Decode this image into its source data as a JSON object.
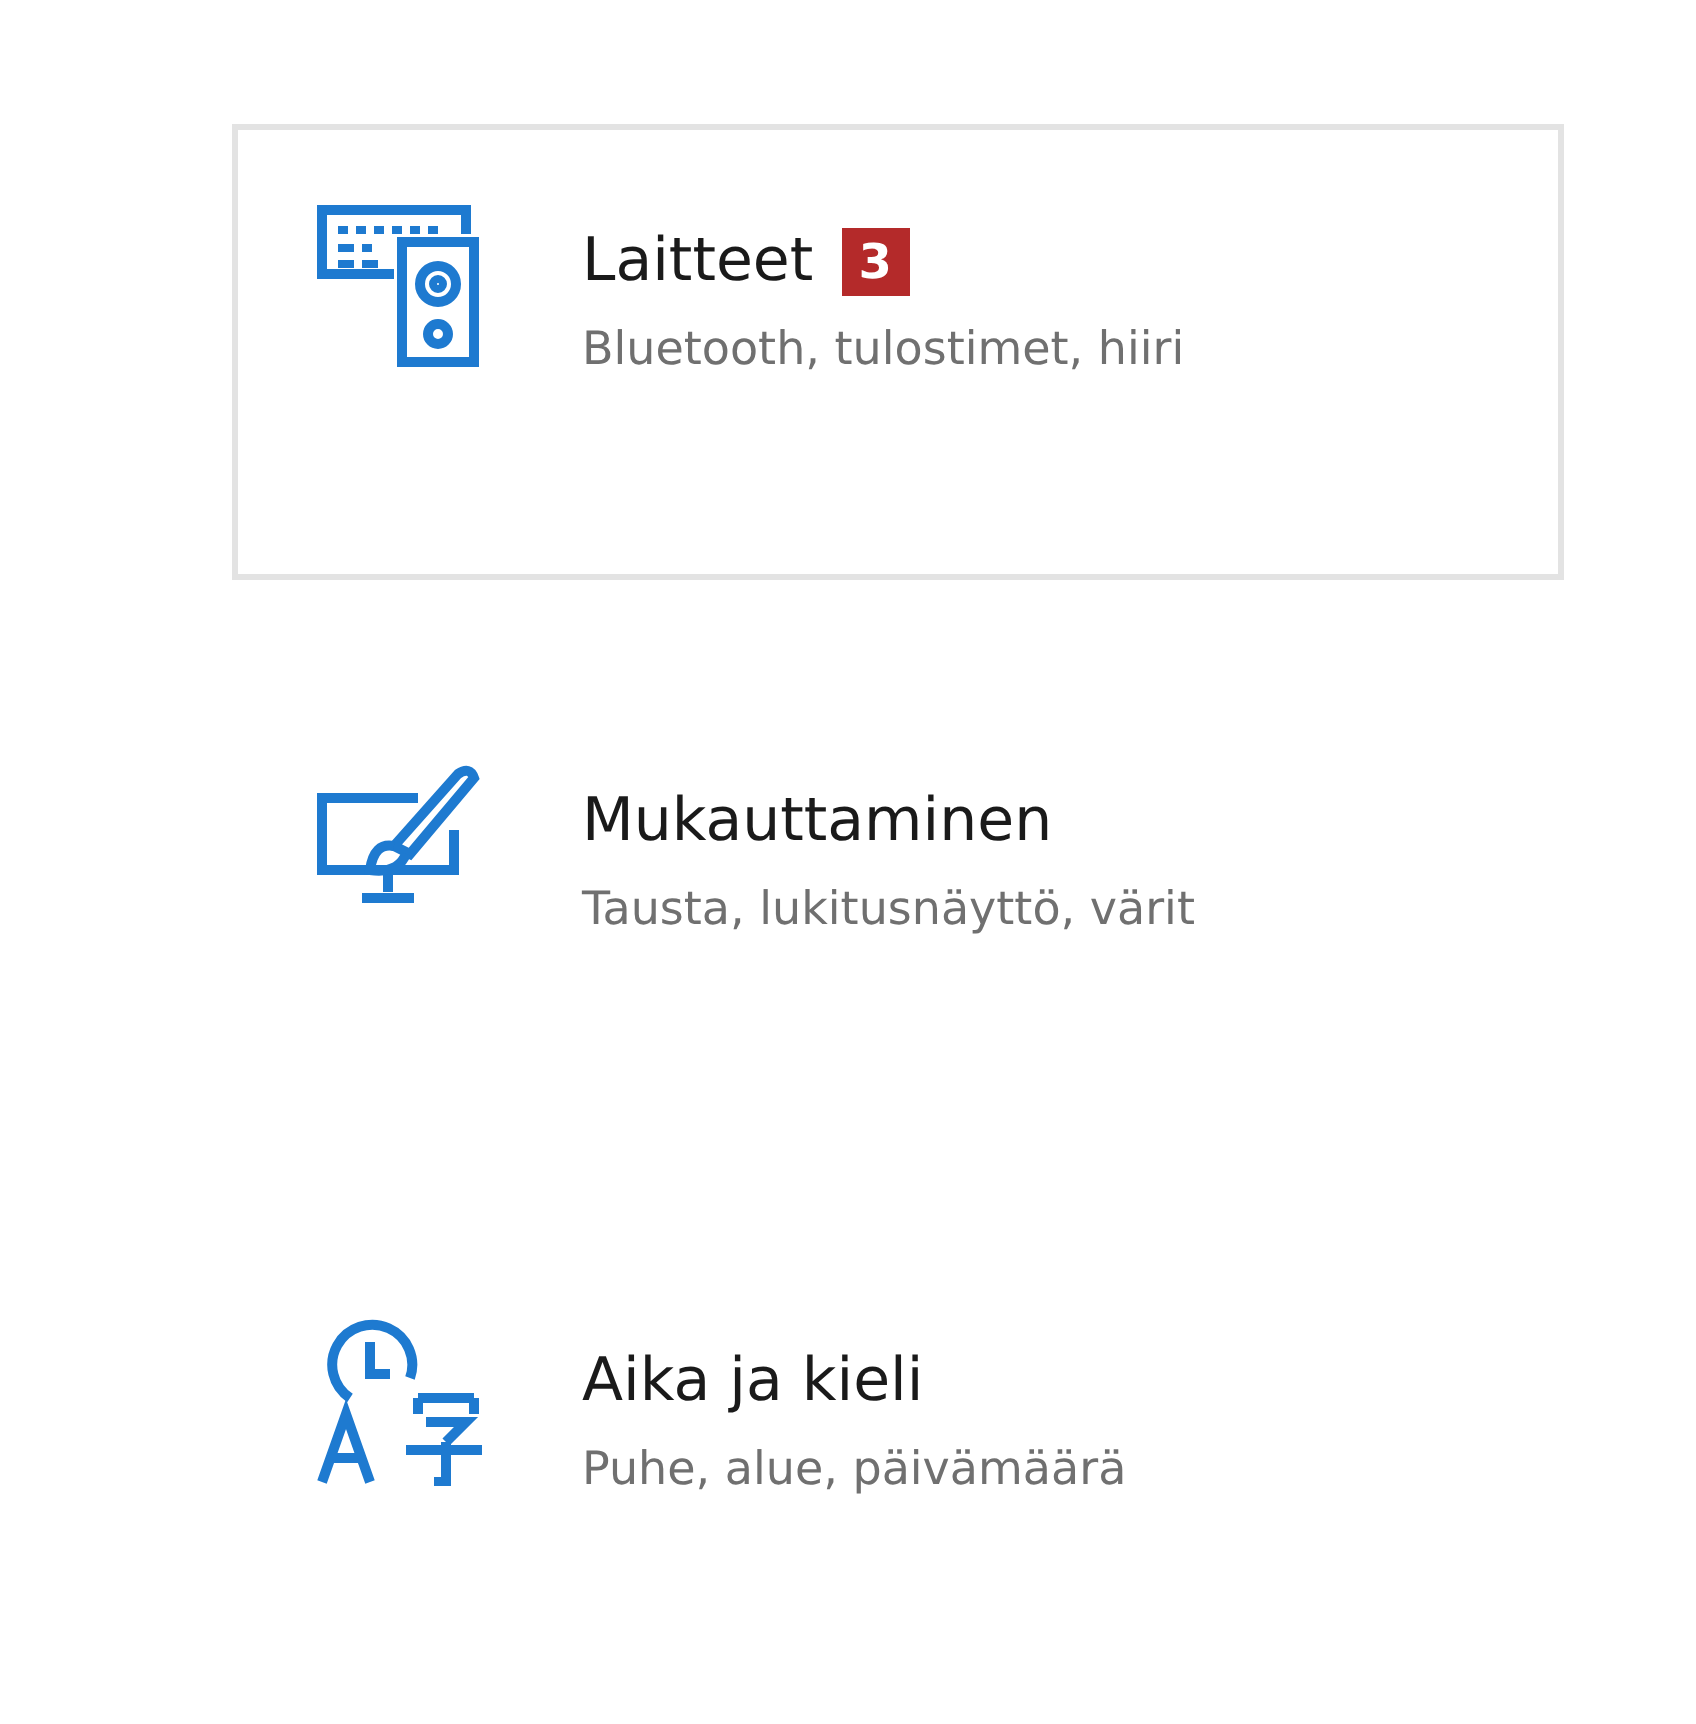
{
  "categories": [
    {
      "kind": "devices",
      "title": "Laitteet",
      "badge": "3",
      "subtitle": "Bluetooth, tulostimet, hiiri",
      "selected": true
    },
    {
      "kind": "personalization",
      "title": "Mukauttaminen",
      "subtitle": "Tausta, lukitusnäyttö, värit",
      "selected": false
    },
    {
      "kind": "time-language",
      "title": "Aika ja kieli",
      "subtitle": "Puhe, alue, päivämäärä",
      "selected": false
    }
  ]
}
